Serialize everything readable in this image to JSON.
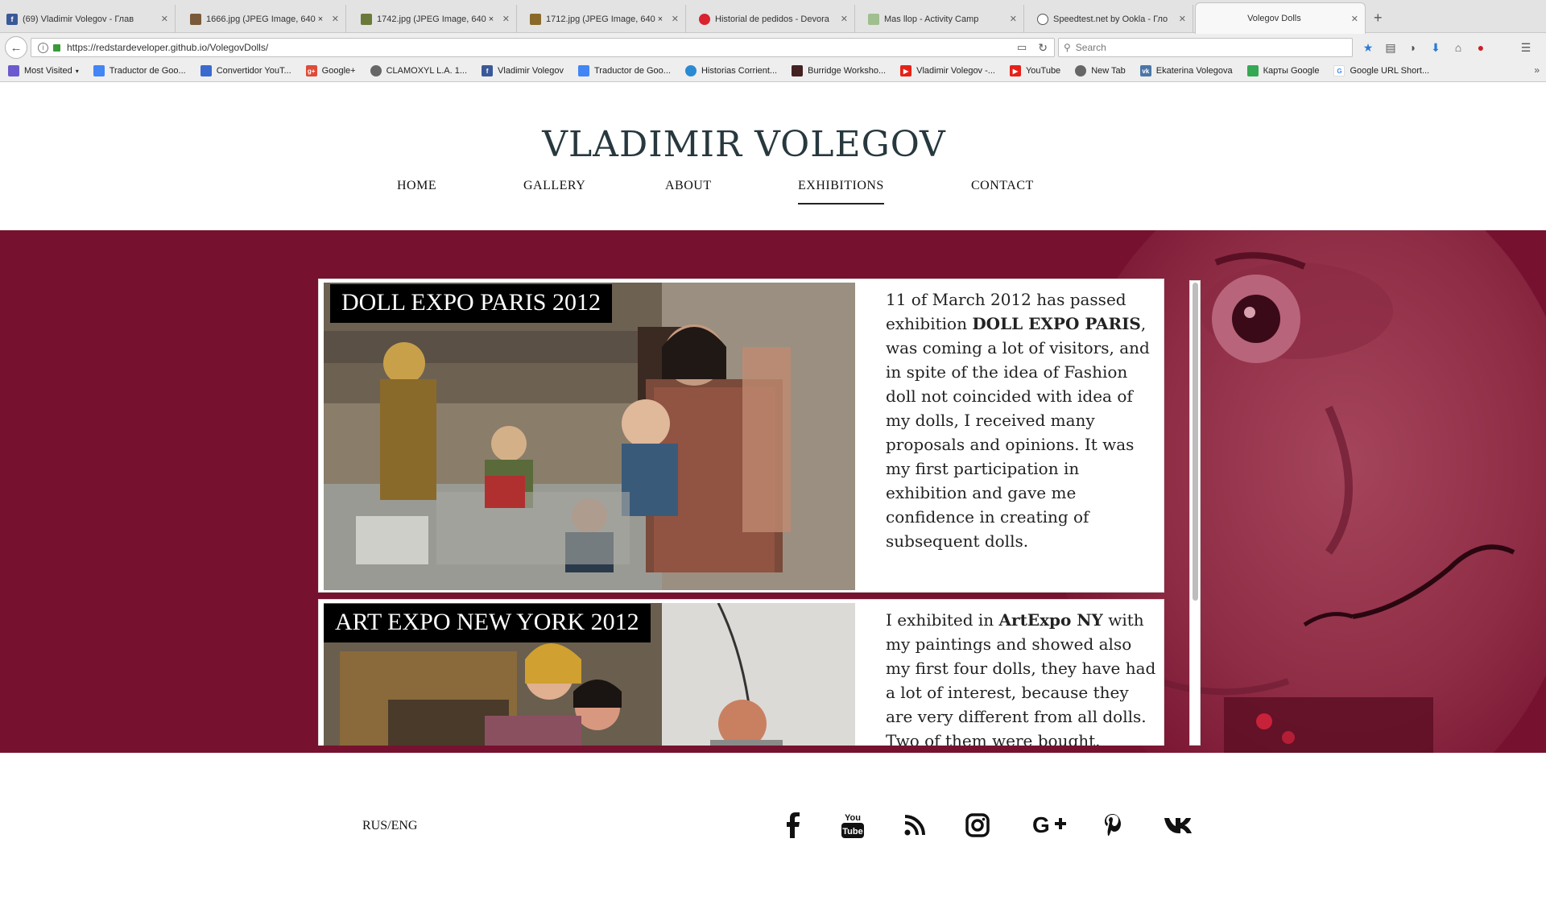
{
  "browser": {
    "tabs": [
      {
        "label": "(69) Vladimir Volegov - Глав",
        "fav_color": "#3b5998",
        "fav_glyph": "f"
      },
      {
        "label": "1666.jpg (JPEG Image, 640 ×",
        "fav_color": "#7a5a3a",
        "fav_glyph": ""
      },
      {
        "label": "1742.jpg (JPEG Image, 640 ×",
        "fav_color": "#6a7a3a",
        "fav_glyph": ""
      },
      {
        "label": "1712.jpg (JPEG Image, 640 ×",
        "fav_color": "#8a6a2a",
        "fav_glyph": ""
      },
      {
        "label": "Historial de pedidos - Devora",
        "fav_color": "#d9232e",
        "fav_glyph": ""
      },
      {
        "label": "Mas llop - Activity Camp",
        "fav_color": "#9fbf8f",
        "fav_glyph": ""
      },
      {
        "label": "Speedtest.net by Ookla - Гло",
        "fav_color": "#555555",
        "fav_glyph": ""
      },
      {
        "label": "Volegov Dolls",
        "fav_color": "",
        "fav_glyph": ""
      }
    ],
    "url": "https://redstardeveloper.github.io/VolegovDolls/",
    "search_placeholder": "Search",
    "bookmarks": [
      {
        "label": "Most Visited",
        "color": "#6a5acd"
      },
      {
        "label": "Traductor de Goo...",
        "color": "#4285f4"
      },
      {
        "label": "Convertidor YouT...",
        "color": "#3a6acd"
      },
      {
        "label": "Google+",
        "color": "#dd4b39"
      },
      {
        "label": "CLAMOXYL L.A. 1...",
        "color": "#666666"
      },
      {
        "label": "Vladimir Volegov",
        "color": "#3b5998"
      },
      {
        "label": "Traductor de Goo...",
        "color": "#4285f4"
      },
      {
        "label": "Historias Corrient...",
        "color": "#2a8ad4"
      },
      {
        "label": "Burridge Worksho...",
        "color": "#442222"
      },
      {
        "label": "Vladimir Volegov -...",
        "color": "#e62117"
      },
      {
        "label": "YouTube",
        "color": "#e62117"
      },
      {
        "label": "New Tab",
        "color": "#666666"
      },
      {
        "label": "Ekaterina Volegova",
        "color": "#4a76a8"
      },
      {
        "label": "Карты Google",
        "color": "#34a853"
      },
      {
        "label": "Google URL Short...",
        "color": "#4285f4"
      }
    ]
  },
  "site": {
    "title": "VLADIMIR VOLEGOV",
    "nav": [
      "HOME",
      "GALLERY",
      "ABOUT",
      "EXHIBITIONS",
      "CONTACT"
    ],
    "active_nav": "EXHIBITIONS",
    "band_color": "#76122f",
    "exhibitions": [
      {
        "title": "DOLL EXPO PARIS 2012",
        "text_parts": [
          {
            "t": "11 of March 2012 has passed exhibition ",
            "b": false
          },
          {
            "t": "DOLL EXPO PARIS",
            "b": true
          },
          {
            "t": ", was coming a lot of visitors, and in spite of the idea of Fashion doll not coincided with idea of my dolls, I received many proposals and opinions. It was my first participation in exhibition and gave me confidence in creating of subsequent dolls.",
            "b": false
          }
        ]
      },
      {
        "title": "ART EXPO NEW YORK 2012",
        "text_parts": [
          {
            "t": "I exhibited in ",
            "b": false
          },
          {
            "t": "ArtExpo NY",
            "b": true
          },
          {
            "t": " with my paintings and showed also my first four dolls, they have had a lot of interest, because they are very different from all dolls. Two of them were bought.",
            "b": false
          }
        ]
      }
    ],
    "footer": {
      "lang": "RUS/ENG",
      "social": [
        "facebook-icon",
        "youtube-icon",
        "rss-icon",
        "instagram-icon",
        "google-plus-icon",
        "pinterest-icon",
        "vk-icon"
      ]
    }
  }
}
